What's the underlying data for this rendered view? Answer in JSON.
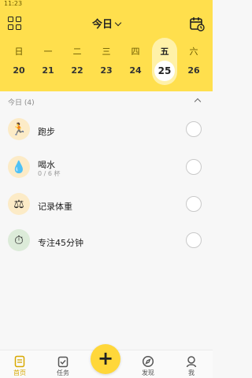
{
  "status_bar": {
    "time": "11:23"
  },
  "header": {
    "title": "今日",
    "week": [
      {
        "weekday": "日",
        "date": "20",
        "active": false
      },
      {
        "weekday": "一",
        "date": "21",
        "active": false
      },
      {
        "weekday": "二",
        "date": "22",
        "active": false
      },
      {
        "weekday": "三",
        "date": "23",
        "active": false
      },
      {
        "weekday": "四",
        "date": "24",
        "active": false
      },
      {
        "weekday": "五",
        "date": "25",
        "active": true
      },
      {
        "weekday": "六",
        "date": "26",
        "active": false
      }
    ]
  },
  "section": {
    "label": "今日 (4)"
  },
  "tasks": [
    {
      "name": "跑步",
      "sub": "",
      "icon": "runner-icon",
      "glyph": "🏃",
      "bg": "#FCEBC7"
    },
    {
      "name": "喝水",
      "sub": "0 / 6 杯",
      "icon": "water-drop-icon",
      "glyph": "💧",
      "bg": "#FCEBC7"
    },
    {
      "name": "记录体重",
      "sub": "",
      "icon": "scale-icon",
      "glyph": "⚖",
      "bg": "#FCEBC7"
    },
    {
      "name": "专注45分钟",
      "sub": "",
      "icon": "timer-icon",
      "glyph": "⏱",
      "bg": "#DCEBD9"
    }
  ],
  "tabbar": {
    "items": [
      {
        "label": "首页",
        "icon": "home-icon"
      },
      {
        "label": "任务",
        "icon": "task-icon"
      },
      {
        "label": "发现",
        "icon": "discover-icon"
      },
      {
        "label": "我",
        "icon": "profile-icon"
      }
    ],
    "fab": "+"
  },
  "colors": {
    "accent": "#FFDF4D",
    "accent_light": "#FFF1A8",
    "active_tab": "#d7a800"
  }
}
